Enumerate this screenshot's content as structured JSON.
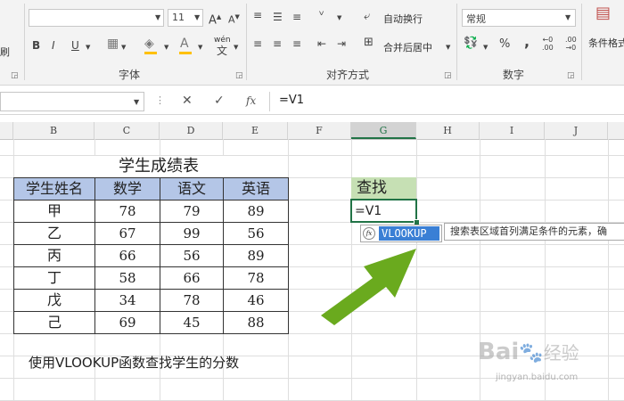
{
  "ribbon": {
    "font_group": {
      "label": "字体",
      "font_size": "11",
      "grow_icon": "A",
      "shrink_icon": "A",
      "bold": "B",
      "italic": "I",
      "underline": "U",
      "phonetic_label": "wén"
    },
    "align_group": {
      "label": "对齐方式",
      "wrap_text": "自动换行",
      "merge_center": "合并后居中"
    },
    "number_group": {
      "label": "数字",
      "format_value": "常规",
      "percent": "%",
      "comma": ","
    },
    "styles_group": {
      "conditional_format": "条件格式"
    },
    "clipboard_group": {
      "brush_label": "刷"
    }
  },
  "formula_bar": {
    "name_box": "",
    "cancel_icon": "✕",
    "enter_icon": "✓",
    "fx_label": "fx",
    "formula": "=V1"
  },
  "columns": [
    "B",
    "C",
    "D",
    "E",
    "F",
    "G",
    "H",
    "I",
    "J"
  ],
  "sheet": {
    "table_title": "学生成绩表",
    "headers": [
      "学生姓名",
      "数学",
      "语文",
      "英语"
    ],
    "rows": [
      [
        "甲",
        "78",
        "79",
        "89"
      ],
      [
        "乙",
        "67",
        "99",
        "56"
      ],
      [
        "丙",
        "66",
        "56",
        "89"
      ],
      [
        "丁",
        "58",
        "66",
        "78"
      ],
      [
        "戊",
        "34",
        "78",
        "46"
      ],
      [
        "己",
        "69",
        "45",
        "88"
      ]
    ],
    "lookup_header": "查找",
    "active_cell_value": "=V1",
    "caption": "使用VLOOKUP函数查找学生的分数"
  },
  "autocomplete": {
    "function_name": "VLOOKUP",
    "function_icon": "fx",
    "tooltip": "搜索表区域首列满足条件的元素，确"
  },
  "watermark": {
    "brand": "Bai",
    "brand_suffix": "经验",
    "url": "jingyan.baidu.com"
  },
  "colors": {
    "header_fill": "#b4c6e7",
    "lookup_fill": "#c6e0b4",
    "active_border": "#217346",
    "arrow": "#6aaa1e",
    "autocomplete_highlight": "#3a7fd5"
  }
}
